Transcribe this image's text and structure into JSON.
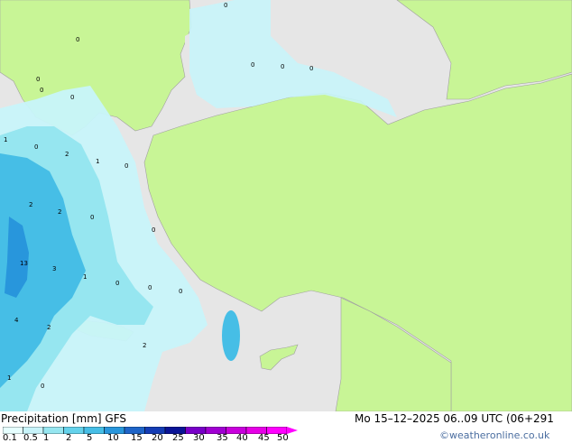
{
  "title": "Precipitation [mm]",
  "model": "GFS",
  "datetime": "Mo 15–12–2025 06..09 UTC (06+291",
  "credit": "©weatheronline.co.uk",
  "legend": {
    "labels": [
      "0.1",
      "0.5",
      "1",
      "2",
      "5",
      "10",
      "15",
      "20",
      "25",
      "30",
      "35",
      "40",
      "45",
      "50"
    ],
    "colors": [
      "#e6ffff",
      "#c8f4fa",
      "#96e6f0",
      "#64d2eb",
      "#46bee6",
      "#2896dc",
      "#1e64c8",
      "#143cb4",
      "#0a1496",
      "#7800c8",
      "#a000d2",
      "#c800dc",
      "#e600e6",
      "#ff00ff"
    ]
  },
  "colors": {
    "sea": "#e6e6e6",
    "land": "#c8f596",
    "precip_light": "#c8f4fa",
    "precip_mid": "#96e6f0",
    "precip_heavy": "#46bee6",
    "precip_max": "#2896dc"
  },
  "map_values": [
    "0",
    "0",
    "0",
    "0",
    "0",
    "0",
    "0",
    "1",
    "0",
    "2",
    "1",
    "0",
    "0",
    "2",
    "2",
    "0",
    "0",
    "13",
    "3",
    "1",
    "0",
    "0",
    "2",
    "4",
    "2",
    "0",
    "1",
    "0"
  ]
}
